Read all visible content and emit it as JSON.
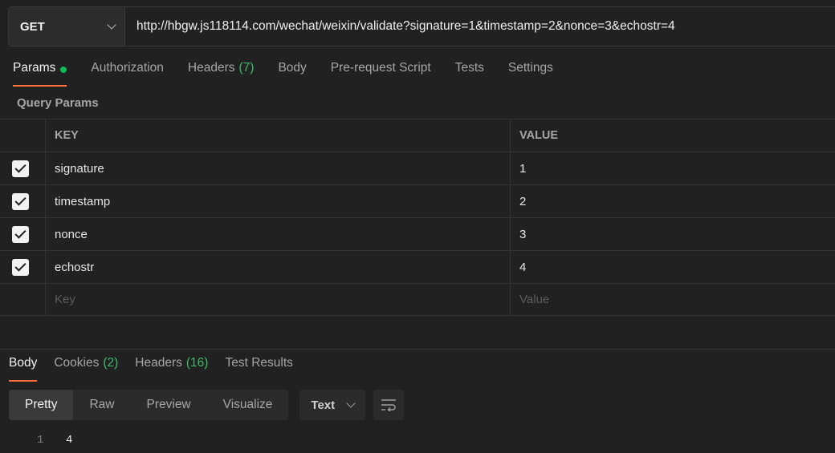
{
  "request": {
    "method": "GET",
    "url": "http://hbgw.js118114.com/wechat/weixin/validate?signature=1&timestamp=2&nonce=3&echostr=4"
  },
  "request_tabs": [
    {
      "label": "Params",
      "count": ""
    },
    {
      "label": "Authorization",
      "count": ""
    },
    {
      "label": "Headers",
      "count": "(7)"
    },
    {
      "label": "Body",
      "count": ""
    },
    {
      "label": "Pre-request Script",
      "count": ""
    },
    {
      "label": "Tests",
      "count": ""
    },
    {
      "label": "Settings",
      "count": ""
    }
  ],
  "query_params": {
    "title": "Query Params",
    "headers": {
      "key": "KEY",
      "value": "VALUE"
    },
    "rows": [
      {
        "key": "signature",
        "value": "1"
      },
      {
        "key": "timestamp",
        "value": "2"
      },
      {
        "key": "nonce",
        "value": "3"
      },
      {
        "key": "echostr",
        "value": "4"
      }
    ],
    "placeholder": {
      "key": "Key",
      "value": "Value"
    }
  },
  "response_tabs": [
    {
      "label": "Body",
      "count": ""
    },
    {
      "label": "Cookies",
      "count": "(2)"
    },
    {
      "label": "Headers",
      "count": "(16)"
    },
    {
      "label": "Test Results",
      "count": ""
    }
  ],
  "view_modes": [
    "Pretty",
    "Raw",
    "Preview",
    "Visualize"
  ],
  "format": "Text",
  "body_lines": [
    {
      "n": "1",
      "text": "4"
    }
  ],
  "colors": {
    "accent": "#ff6c37",
    "status_dot": "#0cbb52",
    "count": "#3dbb6a"
  },
  "icons": {
    "method_dropdown": "chevron-down-icon",
    "wrap": "wrap-lines-icon"
  }
}
